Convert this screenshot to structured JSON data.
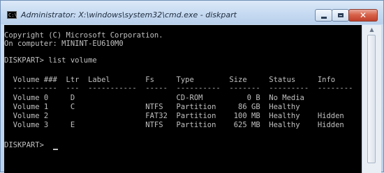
{
  "window": {
    "title": "Administrator: X:\\windows\\system32\\cmd.exe - diskpart",
    "icon": "C:\\",
    "controls": {
      "minimize": "minimize-icon",
      "maximize": "maximize-icon",
      "close_glyph": "✕"
    }
  },
  "console": {
    "colors": {
      "background": "#000000",
      "text": "#c0c0c0"
    },
    "lines": [
      "Copyright (C) Microsoft Corporation.",
      "On computer: MININT-EU610M0",
      "",
      "DISKPART> list volume",
      "",
      "  Volume ###  Ltr  Label        Fs     Type        Size     Status     Info",
      "  ----------  ---  -----------  -----  ----------  -------  ---------  --------",
      "  Volume 0     D                       CD-ROM          0 B  No Media",
      "  Volume 1     C                NTFS   Partition     86 GB  Healthy",
      "  Volume 2                      FAT32  Partition    100 MB  Healthy    Hidden",
      "  Volume 3     E                NTFS   Partition    625 MB  Healthy    Hidden",
      "",
      "DISKPART> "
    ]
  }
}
